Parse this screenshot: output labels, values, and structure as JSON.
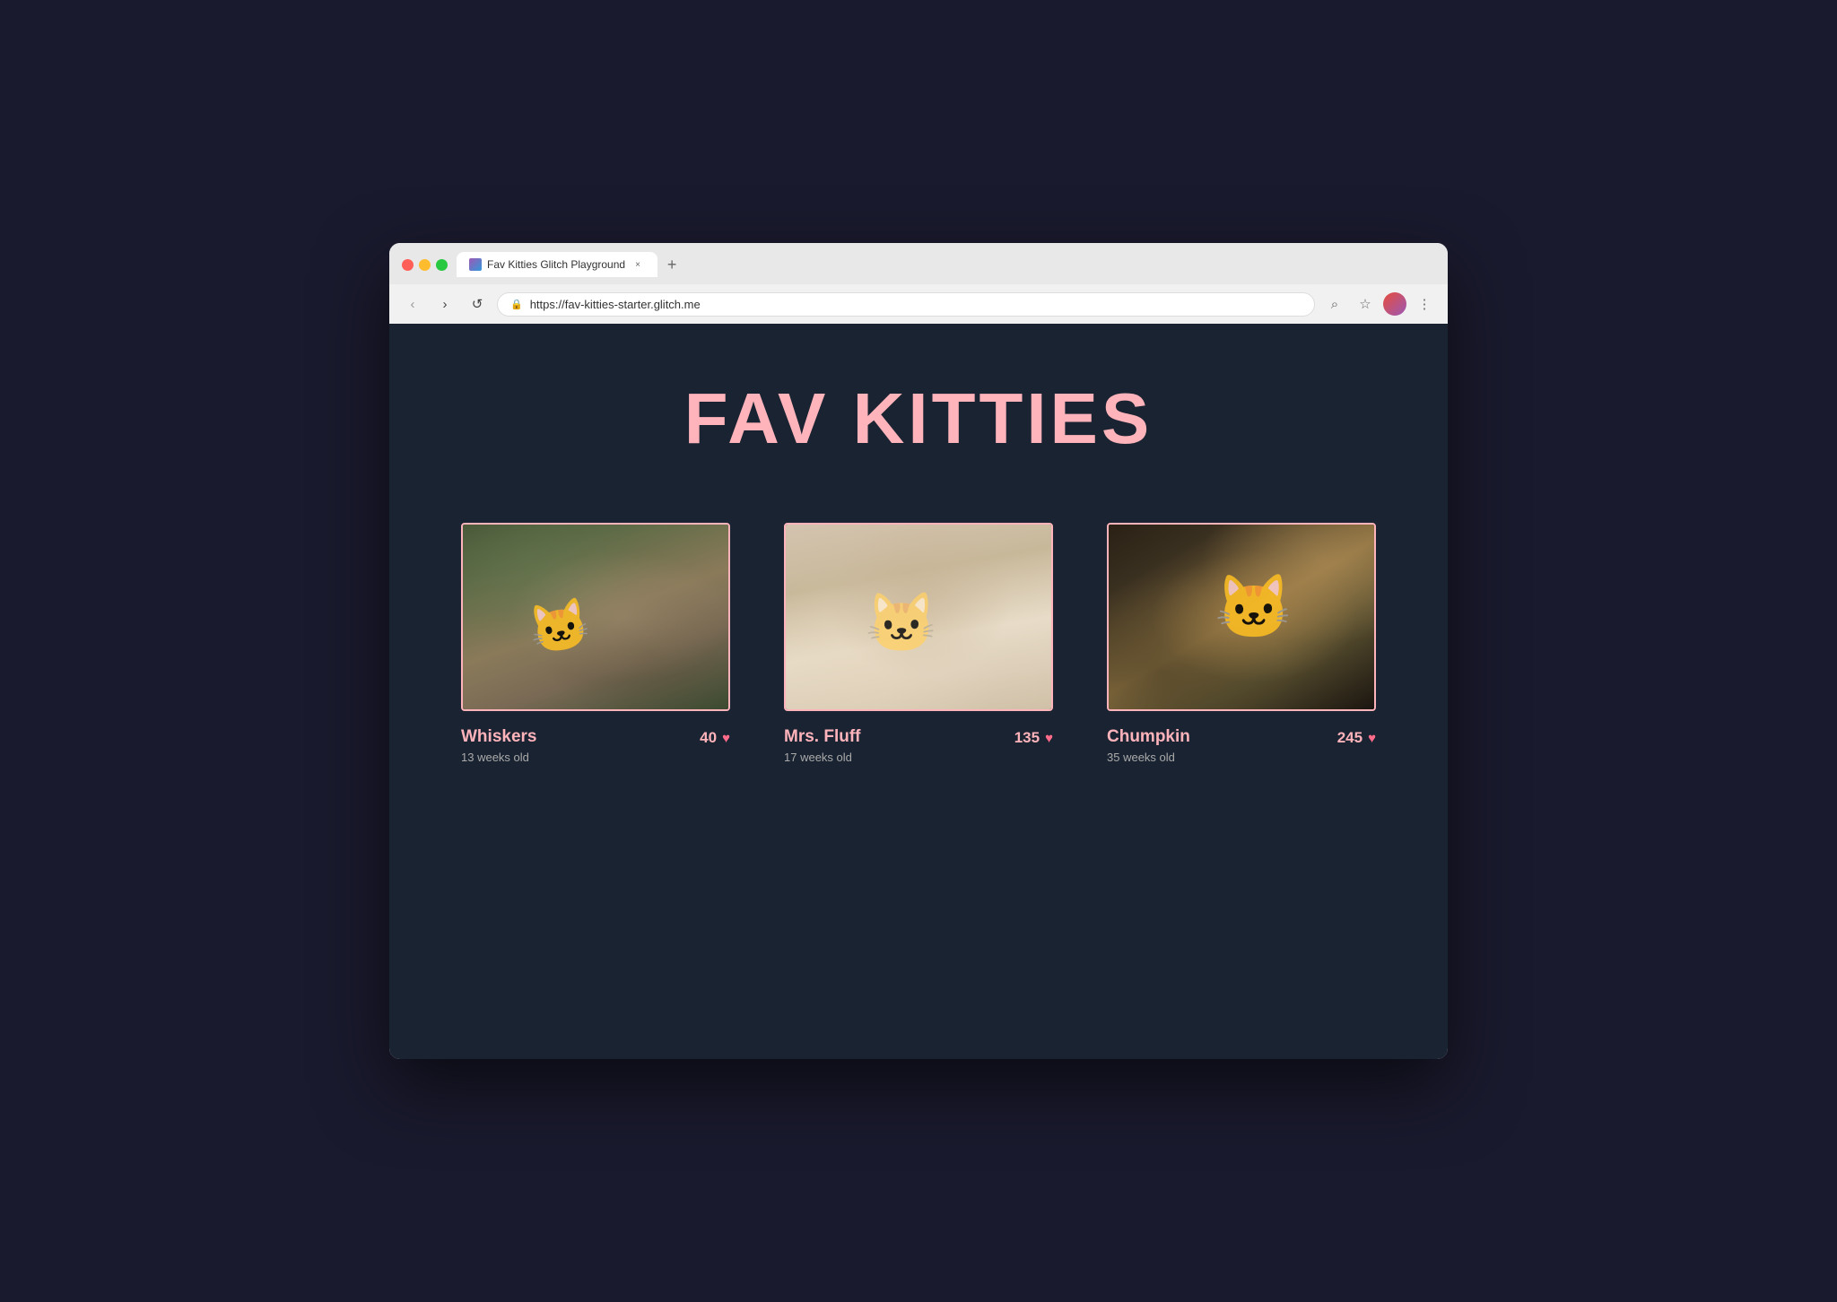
{
  "browser": {
    "tab_title": "Fav Kitties Glitch Playground",
    "tab_close": "×",
    "tab_new": "+",
    "url": "https://fav-kitties-starter.glitch.me",
    "nav_back": "‹",
    "nav_forward": "›",
    "nav_refresh": "↺",
    "lock_icon": "🔒",
    "search_icon": "⌕",
    "star_icon": "☆",
    "menu_icon": "⋮"
  },
  "page": {
    "title": "FAV KITTIES",
    "kitties": [
      {
        "name": "Whiskers",
        "age": "13 weeks old",
        "votes": "40",
        "theme": "whiskers"
      },
      {
        "name": "Mrs. Fluff",
        "age": "17 weeks old",
        "votes": "135",
        "theme": "fluff"
      },
      {
        "name": "Chumpkin",
        "age": "35 weeks old",
        "votes": "245",
        "theme": "chumpkin"
      }
    ]
  },
  "icons": {
    "heart": "♥",
    "close": "×",
    "plus": "+"
  }
}
